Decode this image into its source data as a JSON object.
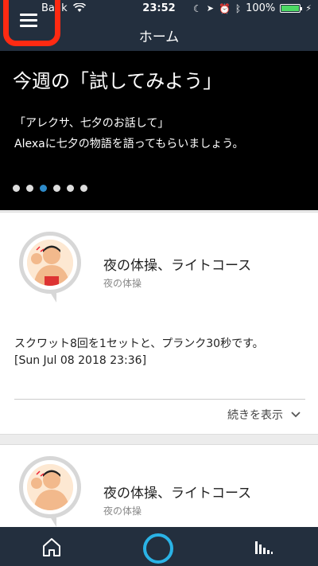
{
  "status_bar": {
    "carrier": "Bank",
    "time": "23:52",
    "battery": "100%",
    "battery_level": 1.0
  },
  "nav": {
    "title": "ホーム"
  },
  "hero": {
    "title": "今週の「試してみよう」",
    "line1": "「アレクサ、七夕のお話して」",
    "line2": "Alexaに七夕の物語を語ってもらいましょう。",
    "dot_count": 6,
    "active_dot": 3
  },
  "cards": [
    {
      "title": "夜の体操、ライトコース",
      "subtitle": "夜の体操",
      "body_line1": "スクワット8回を1セットと、プランク30秒です。",
      "body_line2": "[Sun Jul 08 2018 23:36]",
      "more_label": "続きを表示"
    },
    {
      "title": "夜の体操、ライトコース",
      "subtitle": "夜の体操"
    }
  ],
  "colors": {
    "header": "#232f3e",
    "highlight": "#ff2a12",
    "alexa_ring": "#2ab3e6",
    "active_dot": "#2e8bc9"
  },
  "icons": [
    "wifi-icon",
    "moon-icon",
    "location-icon",
    "alarm-icon",
    "bluetooth-icon",
    "battery-icon",
    "charging-icon",
    "menu-icon",
    "home-icon",
    "alexa-icon",
    "now-playing-icon",
    "chevron-down-icon"
  ]
}
